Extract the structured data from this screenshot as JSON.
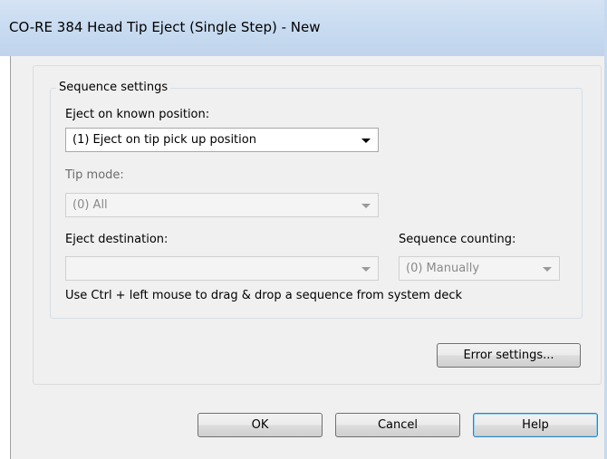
{
  "window": {
    "title": "CO-RE 384 Head Tip Eject (Single Step) - New"
  },
  "sequence_settings": {
    "caption": "Sequence settings",
    "eject_position": {
      "label": "Eject on known position:",
      "value": "(1) Eject on tip pick up position",
      "enabled": true
    },
    "tip_mode": {
      "label": "Tip mode:",
      "value": "(0) All",
      "enabled": false
    },
    "eject_destination": {
      "label": "Eject destination:",
      "value": "",
      "enabled": false
    },
    "sequence_counting": {
      "label": "Sequence counting:",
      "value": "(0) Manually",
      "enabled": false
    },
    "hint": "Use Ctrl + left mouse to drag & drop a sequence from system deck"
  },
  "buttons": {
    "error_settings": "Error settings...",
    "ok": "OK",
    "cancel": "Cancel",
    "help": "Help"
  }
}
